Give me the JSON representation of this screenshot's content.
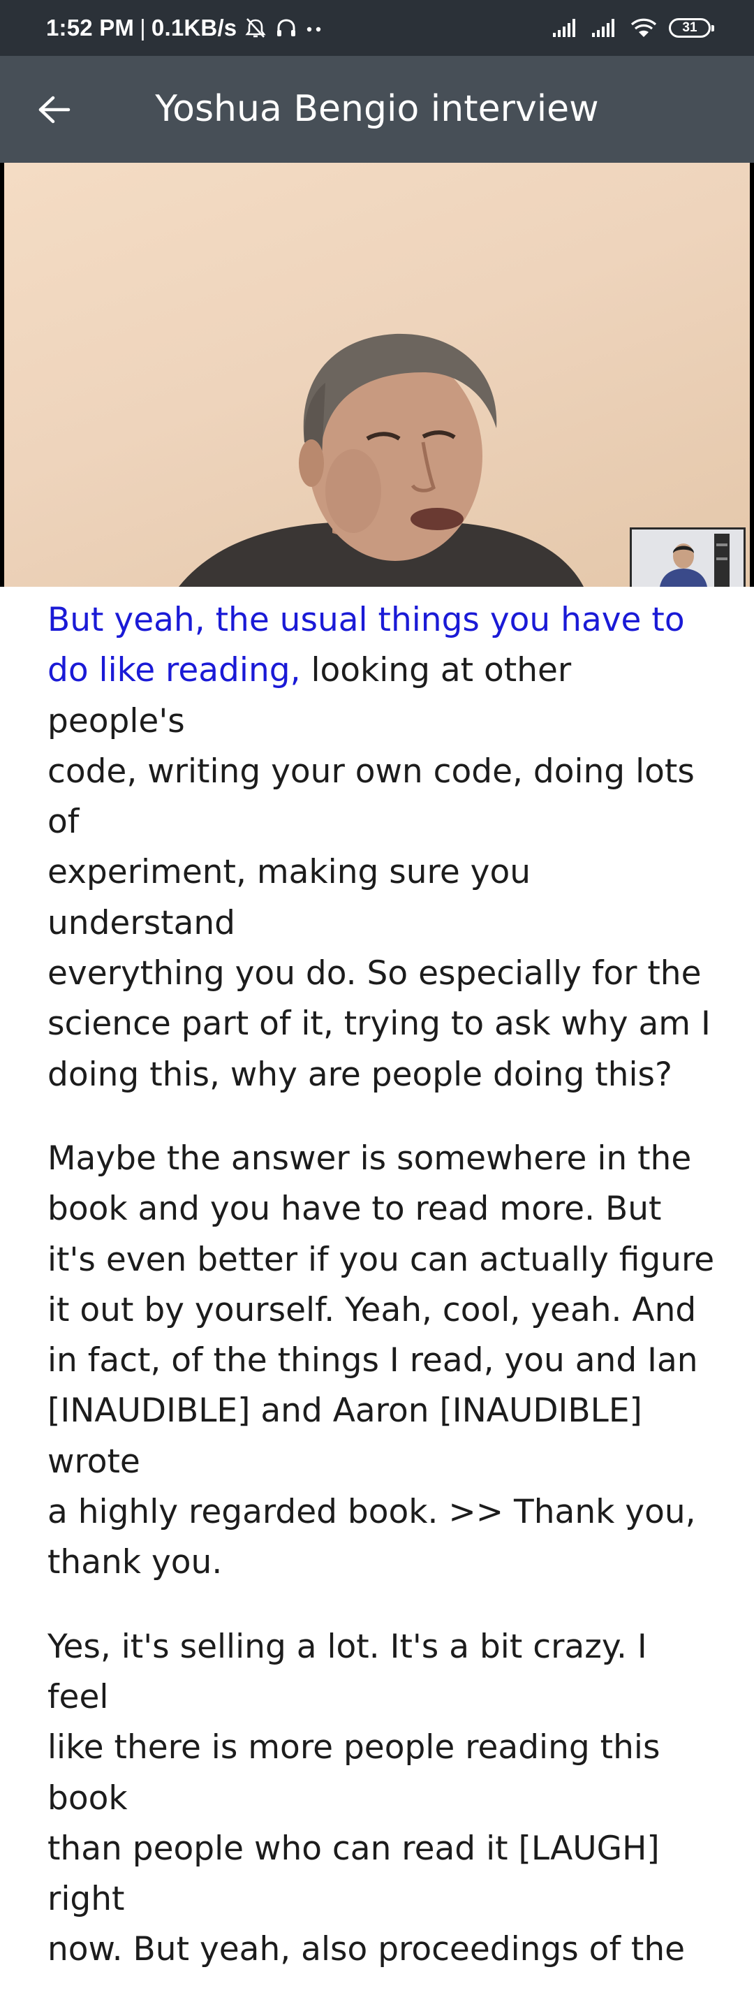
{
  "status_bar": {
    "time": "1:52 PM",
    "separator": "|",
    "network_speed": "0.1KB/s",
    "battery_level": "31",
    "icons": [
      "alarm-off-icon",
      "headphones-icon",
      "more-dots-icon",
      "signal-icon",
      "signal-icon",
      "wifi-icon",
      "battery-icon"
    ]
  },
  "app_bar": {
    "title": "Yoshua Bengio interview",
    "back_icon": "arrow-back-icon"
  },
  "transcript": {
    "paragraph_1_highlight": "But yeah, the usual things you have to\ndo like reading,",
    "paragraph_1_rest": " looking at other people's\ncode, writing your own code, doing lots of\nexperiment, making sure you understand\neverything you do. So especially for the\nscience part of it, trying to ask why am I\ndoing this, why are people doing this?",
    "paragraph_2": "Maybe the answer is somewhere in the\nbook and you have to read more. But\nit's even better if you can actually figure\nit out by yourself. Yeah, cool, yeah. And\nin fact, of the things I read, you and Ian\n[INAUDIBLE] and Aaron [INAUDIBLE] wrote\na highly regarded book. >> Thank you,\nthank you.",
    "paragraph_3": "Yes, it's selling a lot. It's a bit crazy. I feel\nlike there is more people reading this book\nthan people who can read it [LAUGH] right\nnow. But yeah, also proceedings of the"
  },
  "colors": {
    "status_bar_bg": "#2b3138",
    "app_bar_bg": "#474f57",
    "highlight_text": "#1a1ad6",
    "body_text": "#1c1c1c"
  }
}
